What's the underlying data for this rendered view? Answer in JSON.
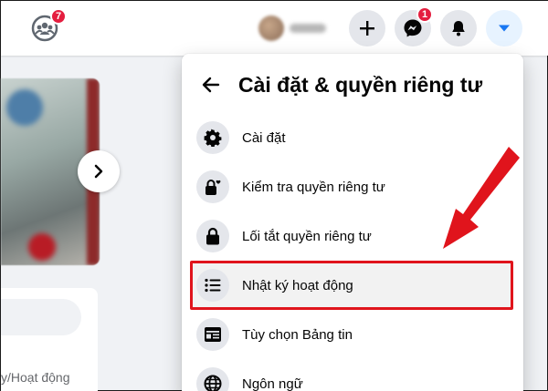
{
  "header": {
    "groups_badge": "7",
    "messenger_badge": "1",
    "icons": [
      "groups-icon",
      "plus-icon",
      "messenger-icon",
      "bell-icon",
      "caret-down-icon"
    ],
    "accent": "#1877f2",
    "badge_color": "#e41e3f"
  },
  "menu": {
    "title": "Cài đặt & quyền riêng tư",
    "items": [
      {
        "label": "Cài đặt",
        "icon": "gear-icon"
      },
      {
        "label": "Kiểm tra quyền riêng tư",
        "icon": "lock-heart-icon"
      },
      {
        "label": "Lối tắt quyền riêng tư",
        "icon": "lock-icon"
      },
      {
        "label": "Nhật ký hoạt động",
        "icon": "list-icon"
      },
      {
        "label": "Tùy chọn Bảng tin",
        "icon": "feed-icon"
      },
      {
        "label": "Ngôn ngữ",
        "icon": "globe-icon"
      }
    ]
  },
  "left": {
    "partial_label": "y/Hoạt động"
  },
  "annotation": {
    "highlight_color": "#e0141c",
    "highlighted_item": "Nhật ký hoạt động"
  }
}
